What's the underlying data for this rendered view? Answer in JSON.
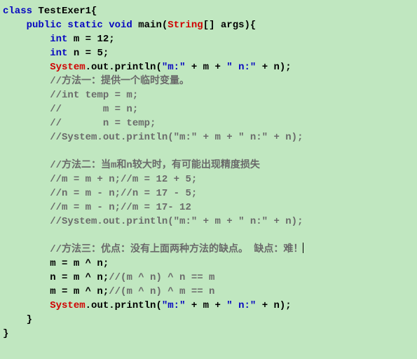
{
  "code": {
    "lines": [
      {
        "indent": 0,
        "segments": [
          {
            "cls": "kw-blue",
            "text": "class"
          },
          {
            "cls": "plain",
            "text": " TestExer1{"
          }
        ]
      },
      {
        "indent": 1,
        "segments": [
          {
            "cls": "kw-blue",
            "text": "public static void"
          },
          {
            "cls": "plain",
            "text": " main("
          },
          {
            "cls": "kw-red",
            "text": "String"
          },
          {
            "cls": "plain",
            "text": "[] args){"
          }
        ]
      },
      {
        "indent": 2,
        "segments": [
          {
            "cls": "kw-blue",
            "text": "int"
          },
          {
            "cls": "plain",
            "text": " m = 12;"
          }
        ]
      },
      {
        "indent": 2,
        "segments": [
          {
            "cls": "kw-blue",
            "text": "int"
          },
          {
            "cls": "plain",
            "text": " n = 5;"
          }
        ]
      },
      {
        "indent": 2,
        "segments": [
          {
            "cls": "kw-red",
            "text": "System"
          },
          {
            "cls": "plain",
            "text": ".out.println("
          },
          {
            "cls": "string",
            "text": "\"m:\""
          },
          {
            "cls": "plain",
            "text": " + m + "
          },
          {
            "cls": "string",
            "text": "\" n:\""
          },
          {
            "cls": "plain",
            "text": " + n);"
          }
        ]
      },
      {
        "indent": 2,
        "segments": [
          {
            "cls": "comment",
            "text": "//方法一：提供一个临时变量。"
          }
        ]
      },
      {
        "indent": 2,
        "segments": [
          {
            "cls": "comment",
            "text": "//int temp = m;"
          }
        ]
      },
      {
        "indent": 2,
        "segments": [
          {
            "cls": "comment",
            "text": "//       m = n;"
          }
        ]
      },
      {
        "indent": 2,
        "segments": [
          {
            "cls": "comment",
            "text": "//       n = temp;"
          }
        ]
      },
      {
        "indent": 2,
        "segments": [
          {
            "cls": "comment",
            "text": "//System.out.println(\"m:\" + m + \" n:\" + n);"
          }
        ]
      },
      {
        "indent": 2,
        "segments": [
          {
            "cls": "plain",
            "text": ""
          }
        ]
      },
      {
        "indent": 2,
        "segments": [
          {
            "cls": "comment",
            "text": "//方法二：当m和n较大时，有可能出现精度损失"
          }
        ]
      },
      {
        "indent": 2,
        "segments": [
          {
            "cls": "comment",
            "text": "//m = m + n;//m = 12 + 5;"
          }
        ]
      },
      {
        "indent": 2,
        "segments": [
          {
            "cls": "comment",
            "text": "//n = m - n;//n = 17 - 5;"
          }
        ]
      },
      {
        "indent": 2,
        "segments": [
          {
            "cls": "comment",
            "text": "//m = m - n;//m = 17- 12"
          }
        ]
      },
      {
        "indent": 2,
        "segments": [
          {
            "cls": "comment",
            "text": "//System.out.println(\"m:\" + m + \" n:\" + n);"
          }
        ]
      },
      {
        "indent": 2,
        "segments": [
          {
            "cls": "plain",
            "text": ""
          }
        ]
      },
      {
        "indent": 2,
        "segments": [
          {
            "cls": "comment",
            "text": "//方法三：优点：没有上面两种方法的缺点。 缺点：难！"
          }
        ],
        "cursor_after": true
      },
      {
        "indent": 2,
        "segments": [
          {
            "cls": "plain",
            "text": "m = m ^ n;"
          }
        ]
      },
      {
        "indent": 2,
        "segments": [
          {
            "cls": "plain",
            "text": "n = m ^ n;"
          },
          {
            "cls": "comment",
            "text": "//(m ^ n) ^ n == m"
          }
        ]
      },
      {
        "indent": 2,
        "segments": [
          {
            "cls": "plain",
            "text": "m = m ^ n;"
          },
          {
            "cls": "comment",
            "text": "//(m ^ n) ^ m == n"
          }
        ]
      },
      {
        "indent": 2,
        "segments": [
          {
            "cls": "kw-red",
            "text": "System"
          },
          {
            "cls": "plain",
            "text": ".out.println("
          },
          {
            "cls": "string",
            "text": "\"m:\""
          },
          {
            "cls": "plain",
            "text": " + m + "
          },
          {
            "cls": "string",
            "text": "\" n:\""
          },
          {
            "cls": "plain",
            "text": " + n);"
          }
        ]
      },
      {
        "indent": 1,
        "segments": [
          {
            "cls": "plain",
            "text": "}"
          }
        ]
      },
      {
        "indent": 0,
        "segments": [
          {
            "cls": "plain",
            "text": "}"
          }
        ]
      }
    ],
    "indent_unit": "    "
  }
}
